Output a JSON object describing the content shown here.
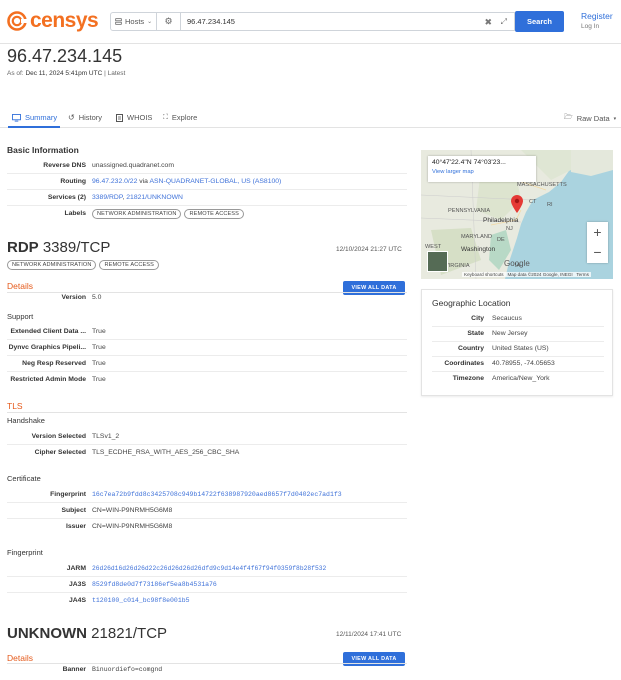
{
  "header": {
    "logo_text": "censys",
    "search_type": "Hosts",
    "search_value": "96.47.234.145",
    "search_button": "Search",
    "register": "Register",
    "login": "Log In",
    "brand_color": "#f37021",
    "accent_color": "#2f6fda"
  },
  "host": {
    "ip": "96.47.234.145",
    "as_of_prefix": "As of:",
    "as_of_date": "Dec 11, 2024 5:41pm UTC",
    "as_of_suffix": "| Latest"
  },
  "tabs": {
    "summary": "Summary",
    "history": "History",
    "whois": "WHOIS",
    "explore": "Explore",
    "raw_data": "Raw Data"
  },
  "basic_info": {
    "title": "Basic Information",
    "reverse_dns_label": "Reverse DNS",
    "reverse_dns": "unassigned.quadranet.com",
    "routing_label": "Routing",
    "routing_prefix": "96.47.232.0/22",
    "routing_via": "via",
    "routing_asn": "ASN-QUADRANET-GLOBAL, US",
    "routing_asnum": "(AS8100)",
    "services_label": "Services (2)",
    "services_1": "3389/RDP",
    "services_sep": ",",
    "services_2": "21821/UNKNOWN",
    "labels_label": "Labels",
    "label_1": "NETWORK ADMINISTRATION",
    "label_2": "REMOTE ACCESS"
  },
  "rdp": {
    "name": "RDP",
    "port": "3389/TCP",
    "date": "12/10/2024 21:27 UTC",
    "label_1": "NETWORK ADMINISTRATION",
    "label_2": "REMOTE ACCESS",
    "details": "Details",
    "view_all": "VIEW ALL DATA",
    "version_label": "Version",
    "version": "5.0",
    "support_title": "Support",
    "support": [
      {
        "label": "Extended Client Data ...",
        "value": "True"
      },
      {
        "label": "Dynvc Graphics Pipeli...",
        "value": "True"
      },
      {
        "label": "Neg Resp Reserved",
        "value": "True"
      },
      {
        "label": "Restricted Admin Mode",
        "value": "True"
      }
    ],
    "tls_title": "TLS",
    "handshake_title": "Handshake",
    "version_selected_label": "Version Selected",
    "version_selected": "TLSv1_2",
    "cipher_selected_label": "Cipher Selected",
    "cipher_selected": "TLS_ECDHE_RSA_WITH_AES_256_CBC_SHA",
    "certificate_title": "Certificate",
    "fingerprint_label": "Fingerprint",
    "fingerprint": "16c7ea72b9fdd8c3425708c949b14722f638987920aed8657f7d0402ec7ad1f3",
    "subject_label": "Subject",
    "subject": "CN=WIN-P9NRMH5G6M8",
    "issuer_label": "Issuer",
    "issuer": "CN=WIN-P9NRMH5G6M8",
    "fp_section_title": "Fingerprint",
    "jarm_label": "JARM",
    "jarm": "26d26d16d26d26d22c26d26d26d26dfd9c9d14e4f4f67f94f0359f8b28f532",
    "ja3s_label": "JA3S",
    "ja3s": "8529fd8de0d7f73186ef5ea8b4531a76",
    "ja4s_label": "JA4S",
    "ja4s": "t120100_c014_bc98f8e001b5"
  },
  "unknown": {
    "name": "UNKNOWN",
    "port": "21821/TCP",
    "date": "12/11/2024 17:41 UTC",
    "details": "Details",
    "view_all": "VIEW ALL DATA",
    "banner_label": "Banner",
    "banner": "Binuordiefo=comgnd"
  },
  "map": {
    "coord": "40°47'22.4\"N 74°03'23...",
    "larger": "View larger map",
    "zoom_in": "+",
    "zoom_out": "−",
    "google": "Google",
    "attr_1": "Keyboard shortcuts",
    "attr_2": "Map data ©2024 Google, INEGI",
    "attr_3": "Terms",
    "labels": {
      "massachusetts": "MASSACHUSETTS",
      "ct": "CT",
      "ri": "RI",
      "pennsylvania": "PENNSYLVANIA",
      "nj": "NJ",
      "philadelphia": "Philadelphia",
      "maryland": "MARYLAND",
      "de": "DE",
      "washington": "Washington",
      "west": "WEST",
      "virginia": "VIRGINIA",
      "ia": "IA"
    }
  },
  "geo": {
    "title": "Geographic Location",
    "rows": [
      {
        "label": "City",
        "value": "Secaucus"
      },
      {
        "label": "State",
        "value": "New Jersey"
      },
      {
        "label": "Country",
        "value": "United States (US)"
      },
      {
        "label": "Coordinates",
        "value": "40.78955, -74.05653"
      },
      {
        "label": "Timezone",
        "value": "America/New_York"
      }
    ]
  }
}
